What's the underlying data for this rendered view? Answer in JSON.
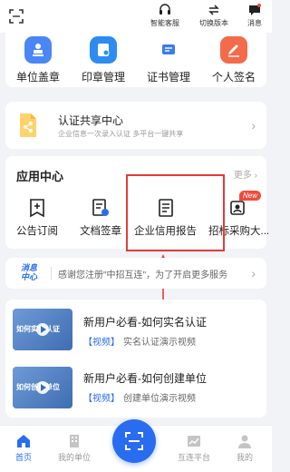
{
  "topbar": {
    "service_label": "智能客服",
    "switch_label": "切换版本",
    "message_label": "消息"
  },
  "quick_actions": [
    {
      "label": "单位盖章",
      "icon": "stamp-icon"
    },
    {
      "label": "印章管理",
      "icon": "seal-manage-icon"
    },
    {
      "label": "证书管理",
      "icon": "certificate-icon"
    },
    {
      "label": "个人签名",
      "icon": "signature-icon"
    }
  ],
  "share": {
    "title": "认证共享中心",
    "subtitle": "企业信息一次录入认证 多平台一键共享"
  },
  "apps": {
    "title": "应用中心",
    "more": "更多",
    "badge": "New",
    "items": [
      {
        "label": "公告订阅",
        "icon": "bookmark-plus-icon"
      },
      {
        "label": "文档签章",
        "icon": "document-sign-icon"
      },
      {
        "label": "企业信用报告",
        "icon": "report-icon"
      },
      {
        "label": "招标采购大...",
        "icon": "procurement-icon"
      }
    ]
  },
  "news": {
    "logo_line1": "消息",
    "logo_line2": "中心",
    "text": "感谢您注册\"中招互连\"，为了开启更多服务"
  },
  "feed": [
    {
      "thumb": "如何实名认证",
      "title": "新用户必看-如何实名认证",
      "tag": "【视频】",
      "desc": "实名认证演示视频"
    },
    {
      "thumb": "如何创建单位",
      "title": "新用户必看-如何创建单位",
      "tag": "【视频】",
      "desc": "创建单位演示视频"
    }
  ],
  "tabbar": {
    "home": "首页",
    "my_unit": "我的单位",
    "platform": "互连平台",
    "mine": "我的"
  },
  "colors": {
    "primary": "#2a6cf0",
    "highlight_box": "#e23b3b",
    "quick_icon_bgs": [
      "#4a86f5",
      "#2d8cf0",
      "#ffffff",
      "#f36b4a"
    ]
  }
}
